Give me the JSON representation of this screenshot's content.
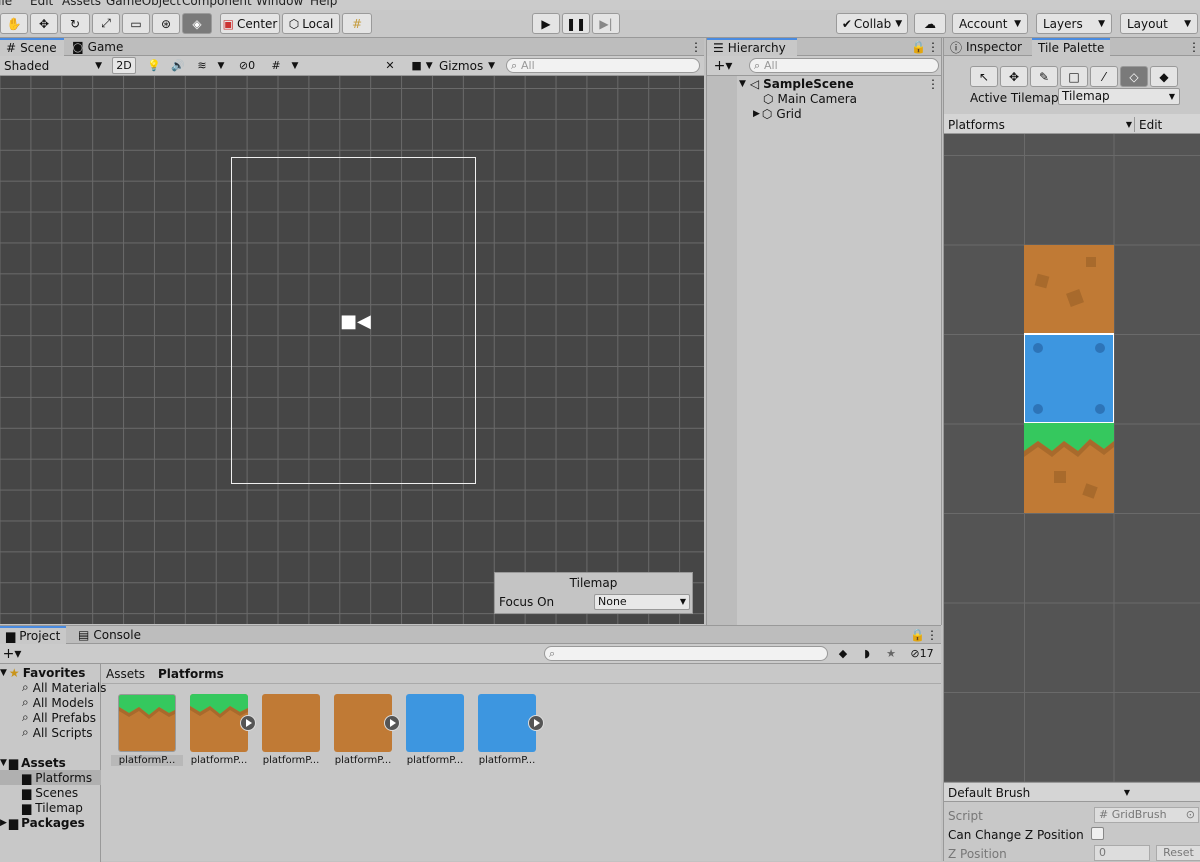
{
  "menu": [
    "File",
    "Edit",
    "Assets",
    "GameObject",
    "Component",
    "Window",
    "Help"
  ],
  "toolbar": {
    "center_label": "Center",
    "local_label": "Local",
    "collab_label": "Collab",
    "account_label": "Account",
    "layers_label": "Layers",
    "layout_label": "Layout"
  },
  "scene_panel": {
    "tab_scene": "Scene",
    "tab_game": "Game",
    "shading_mode": "Shaded",
    "mode_2d": "2D",
    "hidden_count": "0",
    "gizmos_label": "Gizmos",
    "search_placeholder": "All"
  },
  "tilemap_overlay": {
    "title": "Tilemap",
    "focus_label": "Focus On",
    "focus_value": "None"
  },
  "hierarchy": {
    "tab_label": "Hierarchy",
    "search_placeholder": "All",
    "scene_name": "SampleScene",
    "items": [
      "Main Camera",
      "Grid"
    ]
  },
  "palette_panel": {
    "tab_inspector": "Inspector",
    "tab_tile_palette": "Tile Palette",
    "active_tilemap_label": "Active Tilemap",
    "active_tilemap_value": "Tilemap",
    "palette_name": "Platforms",
    "edit_label": "Edit",
    "brush_name": "Default Brush",
    "script_label": "Script",
    "script_value": "GridBrush",
    "z_change_label": "Can Change Z Position",
    "z_position_label": "Z Position",
    "z_position_value": "0",
    "reset_label": "Reset"
  },
  "project_panel": {
    "tab_project": "Project",
    "tab_console": "Console",
    "hidden_count": "17",
    "breadcrumb_root": "Assets",
    "breadcrumb_current": "Platforms",
    "favorites_label": "Favorites",
    "favorites": [
      "All Materials",
      "All Models",
      "All Prefabs",
      "All Scripts"
    ],
    "assets_label": "Assets",
    "folders": [
      "Platforms",
      "Scenes",
      "Tilemap"
    ],
    "packages_label": "Packages",
    "asset_items": [
      {
        "label": "platformP...",
        "kind": "grass"
      },
      {
        "label": "platformP...",
        "kind": "grass"
      },
      {
        "label": "platformP...",
        "kind": "dirt"
      },
      {
        "label": "platformP...",
        "kind": "dirt"
      },
      {
        "label": "platformP...",
        "kind": "blue"
      },
      {
        "label": "platformP...",
        "kind": "blue"
      }
    ]
  },
  "colors": {
    "accent": "#4a8be0",
    "dirt": "#c07a35",
    "grass": "#35c85e",
    "water": "#3d96e0",
    "scene_bg": "#464646"
  }
}
